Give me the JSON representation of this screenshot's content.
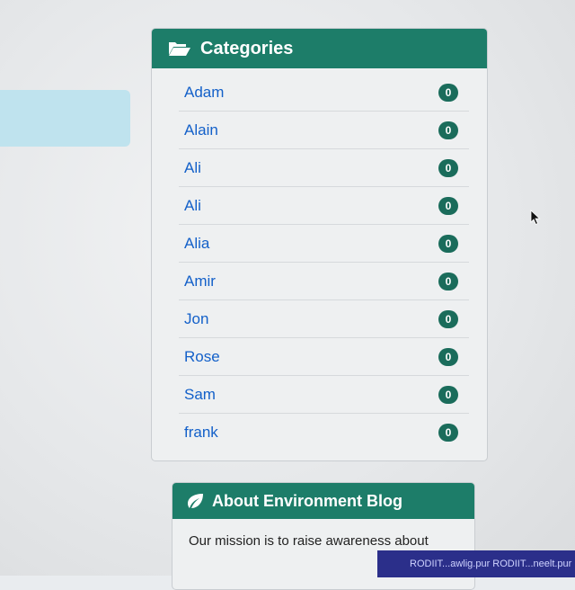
{
  "categories": {
    "title": "Categories",
    "items": [
      {
        "label": "Adam",
        "count": "0"
      },
      {
        "label": "Alain",
        "count": "0"
      },
      {
        "label": "Ali",
        "count": "0"
      },
      {
        "label": "Ali",
        "count": "0"
      },
      {
        "label": "Alia",
        "count": "0"
      },
      {
        "label": "Amir",
        "count": "0"
      },
      {
        "label": "Jon",
        "count": "0"
      },
      {
        "label": "Rose",
        "count": "0"
      },
      {
        "label": "Sam",
        "count": "0"
      },
      {
        "label": "frank",
        "count": "0"
      }
    ]
  },
  "about": {
    "title": "About Environment Blog",
    "text": "Our mission is to raise awareness about"
  },
  "taskbar": {
    "items": "RODIIT...awlig.pur   RODIIT...neelt.pur"
  },
  "icons": {
    "categories_icon": "folder-open-icon",
    "about_icon": "leaf-icon"
  },
  "colors": {
    "header_green": "#1d7d69",
    "badge_green": "#1a6c5b",
    "link_blue": "#1360c9"
  }
}
